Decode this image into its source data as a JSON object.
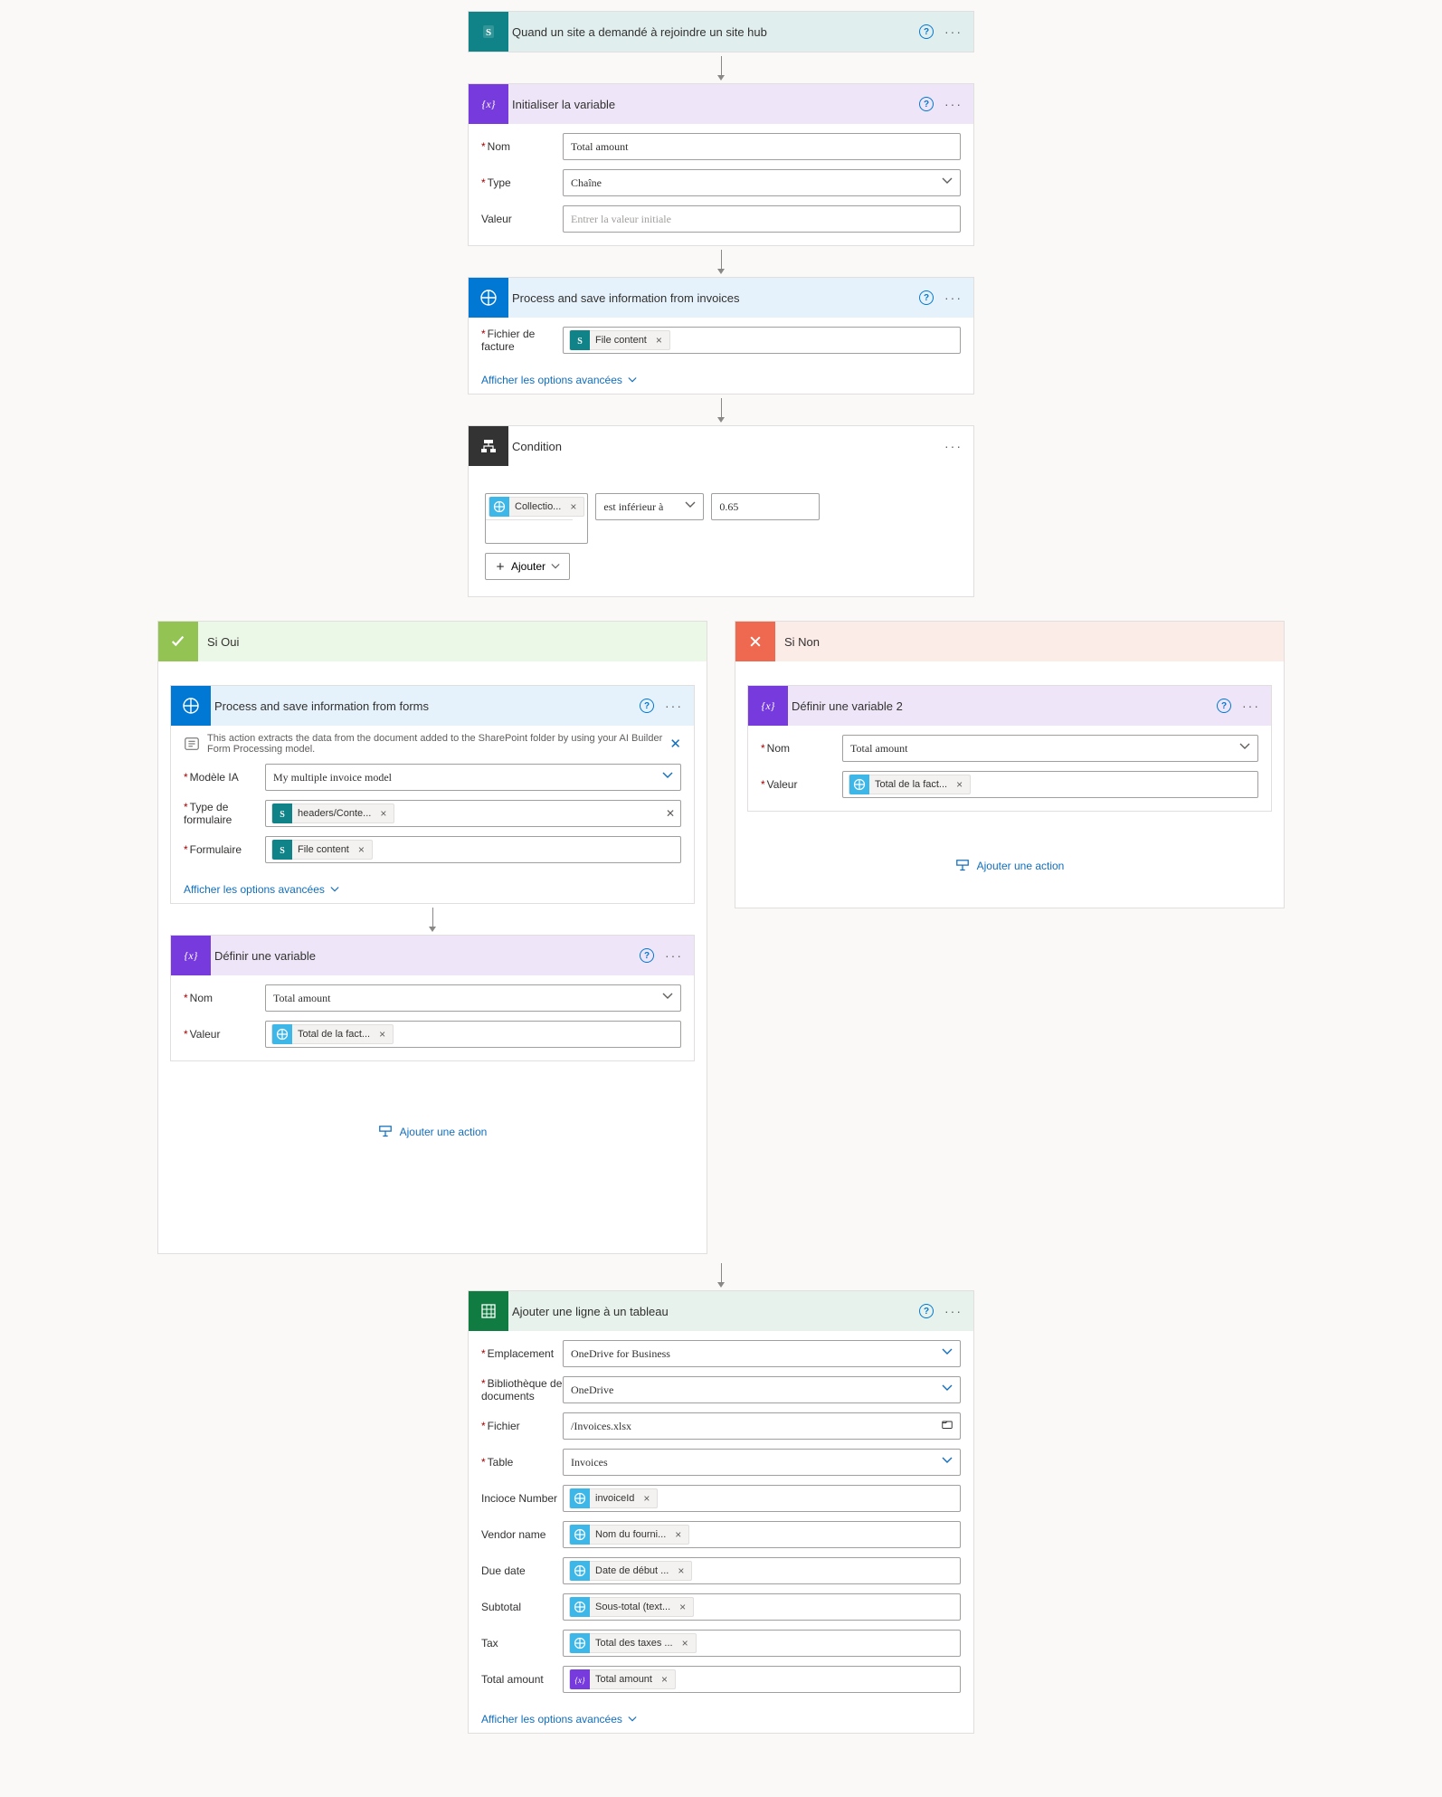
{
  "trigger": {
    "title": "Quand un site a demandé à rejoindre un site hub"
  },
  "init_var": {
    "title": "Initialiser la variable",
    "name_label": "Nom",
    "name_value": "Total amount",
    "type_label": "Type",
    "type_value": "Chaîne",
    "value_label": "Valeur",
    "value_placeholder": "Entrer la valeur initiale"
  },
  "process_invoices": {
    "title": "Process and save information from invoices",
    "field_label": "Fichier de facture",
    "chip_label": "File content",
    "advanced": "Afficher les options avancées"
  },
  "condition": {
    "title": "Condition",
    "chip_label": "Collectio...",
    "operator": "est inférieur à",
    "value": "0.65",
    "add_label": "Ajouter"
  },
  "yes": {
    "title": "Si Oui",
    "forms": {
      "title": "Process and save information from forms",
      "info": "This action extracts the data from the document added to the SharePoint folder by using your AI Builder Form Processing model.",
      "model_label": "Modèle IA",
      "model_value": "My multiple invoice model",
      "type_label": "Type de formulaire",
      "type_chip": "headers/Conte...",
      "form_label": "Formulaire",
      "form_chip": "File content",
      "advanced": "Afficher les options avancées"
    },
    "setvar": {
      "title": "Définir une variable",
      "name_label": "Nom",
      "name_value": "Total amount",
      "value_label": "Valeur",
      "chip_label": "Total de la fact..."
    },
    "add_action": "Ajouter une action"
  },
  "no": {
    "title": "Si Non",
    "setvar": {
      "title": "Définir une variable 2",
      "name_label": "Nom",
      "name_value": "Total amount",
      "value_label": "Valeur",
      "chip_label": "Total de la fact..."
    },
    "add_action": "Ajouter une action"
  },
  "excel": {
    "title": "Ajouter une ligne à un tableau",
    "location_label": "Emplacement",
    "location_value": "OneDrive for Business",
    "lib_label": "Bibliothèque de documents",
    "lib_value": "OneDrive",
    "file_label": "Fichier",
    "file_value": "/Invoices.xlsx",
    "table_label": "Table",
    "table_value": "Invoices",
    "cols": {
      "invoice_num_label": "Incioce Number",
      "invoice_num_chip": "invoiceId",
      "vendor_label": "Vendor name",
      "vendor_chip": "Nom du fourni...",
      "due_label": "Due date",
      "due_chip": "Date de début ...",
      "subtotal_label": "Subtotal",
      "subtotal_chip": "Sous-total (text...",
      "tax_label": "Tax",
      "tax_chip": "Total des taxes ...",
      "total_label": "Total amount",
      "total_chip": "Total amount"
    },
    "advanced": "Afficher les options avancées"
  }
}
